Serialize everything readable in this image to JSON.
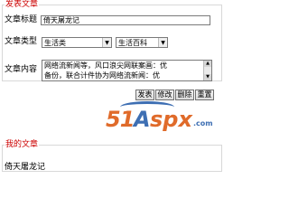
{
  "publish": {
    "legend": "发表文章",
    "title_label": "文章标题",
    "title_value": "倚天屠龙记",
    "type_label": "文章类型",
    "type_primary": "生活类",
    "type_secondary": "生活百科",
    "content_label": "文章内容",
    "content_lines": [
      "网络流新闻等，风口浪尖网联案画：优",
      "备份，联合计件协为网络流新闻：优"
    ],
    "buttons": {
      "publish": "发表",
      "edit": "修改",
      "delete": "删除",
      "reset": "重置"
    }
  },
  "my_articles": {
    "legend": "我的文章",
    "items": [
      "倚天屠龙记"
    ]
  },
  "watermark": {
    "digits": "51",
    "a": "A",
    "spx": "spx",
    "suffix": ".com"
  },
  "colors": {
    "legend": "#cc0000",
    "watermark_orange": "#e06b2a",
    "watermark_blue": "#3e6fb3"
  }
}
